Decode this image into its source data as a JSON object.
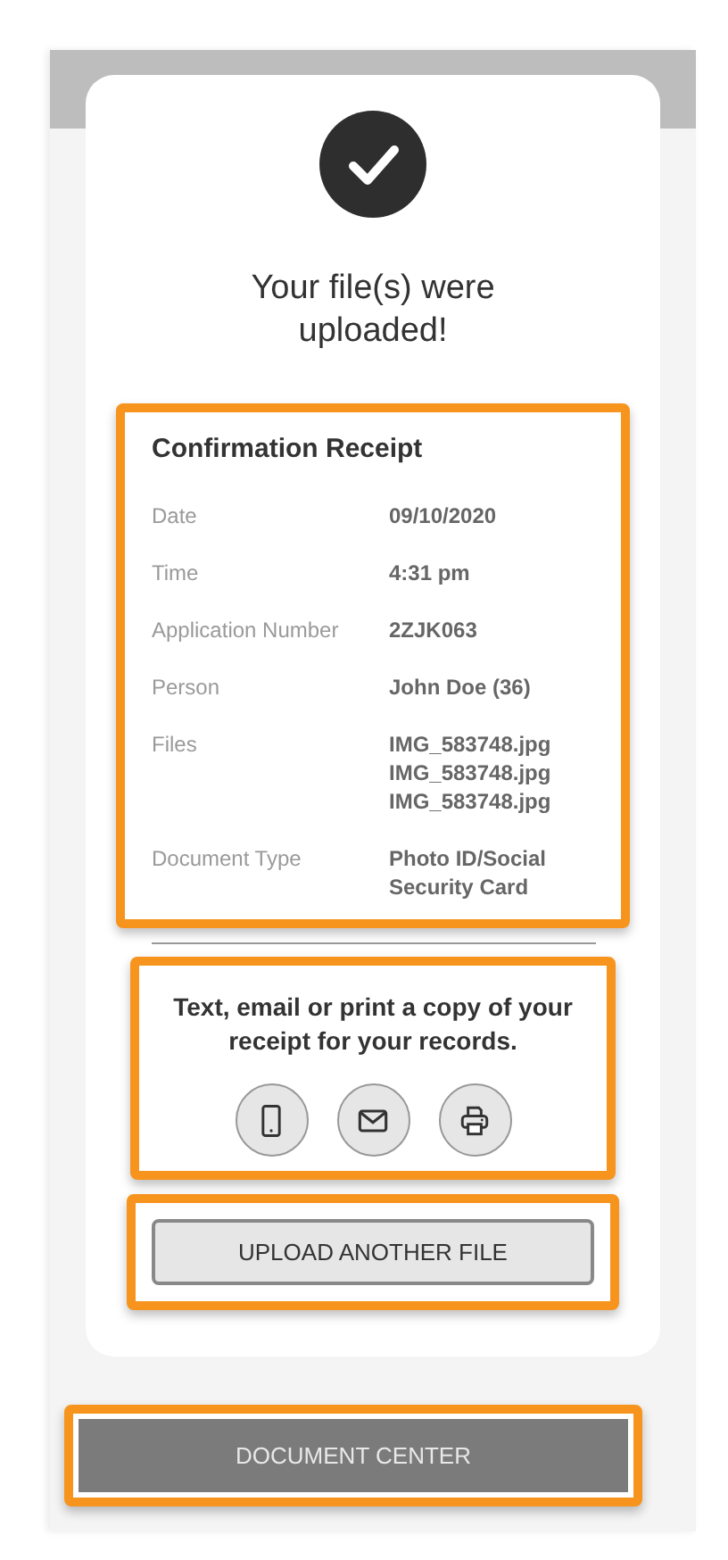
{
  "heading": "Your file(s) were uploaded!",
  "receipt": {
    "title": "Confirmation Receipt",
    "rows": [
      {
        "label": "Date",
        "values": [
          "09/10/2020"
        ]
      },
      {
        "label": "Time",
        "values": [
          "4:31 pm"
        ]
      },
      {
        "label": "Application Number",
        "values": [
          "2ZJK063"
        ]
      },
      {
        "label": "Person",
        "values": [
          "John Doe (36)"
        ]
      },
      {
        "label": "Files",
        "values": [
          "IMG_583748.jpg",
          "IMG_583748.jpg",
          "IMG_583748.jpg"
        ]
      },
      {
        "label": "Document Type",
        "values": [
          "Photo ID/Social Security Card"
        ]
      }
    ]
  },
  "share": {
    "text": "Text, email or print a copy of your receipt for your records.",
    "actions": [
      {
        "kind": "phone"
      },
      {
        "kind": "email"
      },
      {
        "kind": "print"
      }
    ]
  },
  "upload_button": "UPLOAD ANOTHER FILE",
  "document_center_button": "DOCUMENT CENTER"
}
